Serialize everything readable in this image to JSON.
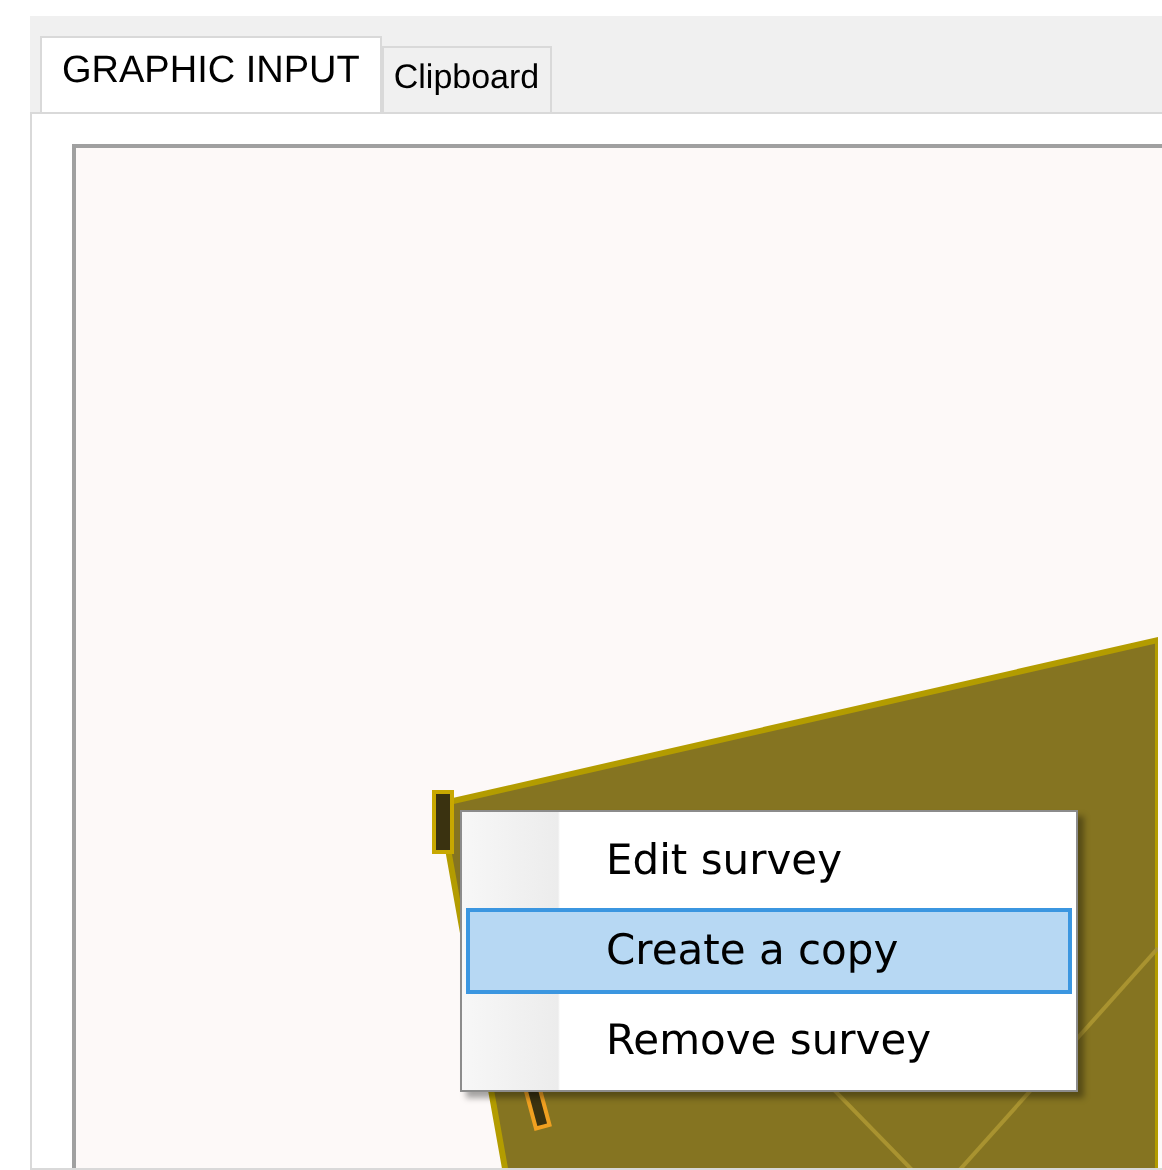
{
  "tabs": [
    {
      "label": "GRAPHIC INPUT",
      "selected": true
    },
    {
      "label": "Clipboard",
      "selected": false
    }
  ],
  "context_menu": {
    "items": [
      {
        "label": "Edit survey",
        "selected": false
      },
      {
        "label": "Create a copy",
        "selected": true
      },
      {
        "label": "Remove survey",
        "selected": false
      }
    ]
  }
}
